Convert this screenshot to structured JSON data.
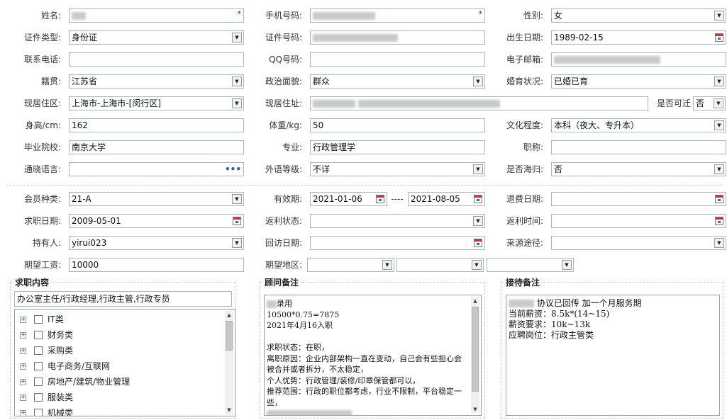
{
  "personal": {
    "name": {
      "label": "姓名:"
    },
    "phone": {
      "label": "手机号码:"
    },
    "gender": {
      "label": "性别:",
      "value": "女"
    },
    "id_type": {
      "label": "证件类型:",
      "value": "身份证"
    },
    "id_no": {
      "label": "证件号码:"
    },
    "birth": {
      "label": "出生日期:",
      "value": "1989-02-15"
    },
    "contact_phone": {
      "label": "联系电话:",
      "value": ""
    },
    "qq": {
      "label": "QQ号码:",
      "value": ""
    },
    "email": {
      "label": "电子邮箱:"
    },
    "native": {
      "label": "籍贯:",
      "value": "江苏省"
    },
    "political": {
      "label": "政治面貌:",
      "value": "群众"
    },
    "marital": {
      "label": "婚育状况:",
      "value": "已婚已育"
    },
    "residence_area": {
      "label": "现居住区:",
      "value": "上海市-上海市-[闵行区]"
    },
    "address": {
      "label": "现居住址:"
    },
    "relocate": {
      "label": "是否可迁",
      "value": "否"
    },
    "height": {
      "label": "身高/cm:",
      "value": "162"
    },
    "weight": {
      "label": "体重/kg:",
      "value": "50"
    },
    "education": {
      "label": "文化程度:",
      "value": "本科（夜大、专升本）"
    },
    "school": {
      "label": "毕业院校:",
      "value": "南京大学"
    },
    "major": {
      "label": "专业:",
      "value": "行政管理学"
    },
    "title": {
      "label": "职称:",
      "value": ""
    },
    "language": {
      "label": "通晓语言:",
      "value": ""
    },
    "foreign_level": {
      "label": "外语等级:",
      "value": "不详"
    },
    "overseas": {
      "label": "是否海归:",
      "value": "否"
    }
  },
  "membership": {
    "member_type": {
      "label": "会员种类:",
      "value": "21-A"
    },
    "validity": {
      "label": "有效期:",
      "start": "2021-01-06",
      "sep": "----",
      "end": "2021-08-05"
    },
    "refund_date": {
      "label": "退费日期:",
      "value": ""
    },
    "job_date": {
      "label": "求职日期:",
      "value": "2009-05-01"
    },
    "rebate_status": {
      "label": "返利状态:",
      "value": ""
    },
    "rebate_time": {
      "label": "返利时间:",
      "value": ""
    },
    "holder": {
      "label": "持有人:",
      "value": "yirui023"
    },
    "revisit_date": {
      "label": "回访日期:",
      "value": ""
    },
    "source": {
      "label": "来源途径:",
      "value": ""
    },
    "salary": {
      "label": "期望工资:",
      "value": "10000"
    },
    "region": {
      "label": "期望地区:"
    }
  },
  "job_panel": {
    "title": "求职内容",
    "selected": "办公室主任/行政经理,行政主管,行政专员",
    "categories": [
      "IT类",
      "财务类",
      "采购类",
      "电子商务/互联网",
      "房地产/建筑/物业管理",
      "服装类",
      "机械类"
    ]
  },
  "advisor_panel": {
    "title": "顾问备注",
    "text_l1": "录用",
    "text_rest": "10500*0.75=7875\n2021年4月16入职\n\n求职状态：在职，\n离职原因：企业内部架构一直在变动，自己会有些担心会被合并或者拆分，不太稳定，\n个人优势：行政管理/装修/印章保管都可以，\n推荐范围：行政的职位都考虑，行业不限制，平台稳定一些，"
  },
  "reception_panel": {
    "title": "接待备注",
    "line1": "协议已回传 加一个月服务期",
    "text_rest": "当前薪资：8.5k*(14~15)\n薪资要求：10k~13k\n应聘岗位：行政主管类"
  },
  "icons": [
    "dropdown-arrow-icon",
    "calendar-icon",
    "ellipsis-icon",
    "tree-expand-icon",
    "checkbox-icon"
  ]
}
